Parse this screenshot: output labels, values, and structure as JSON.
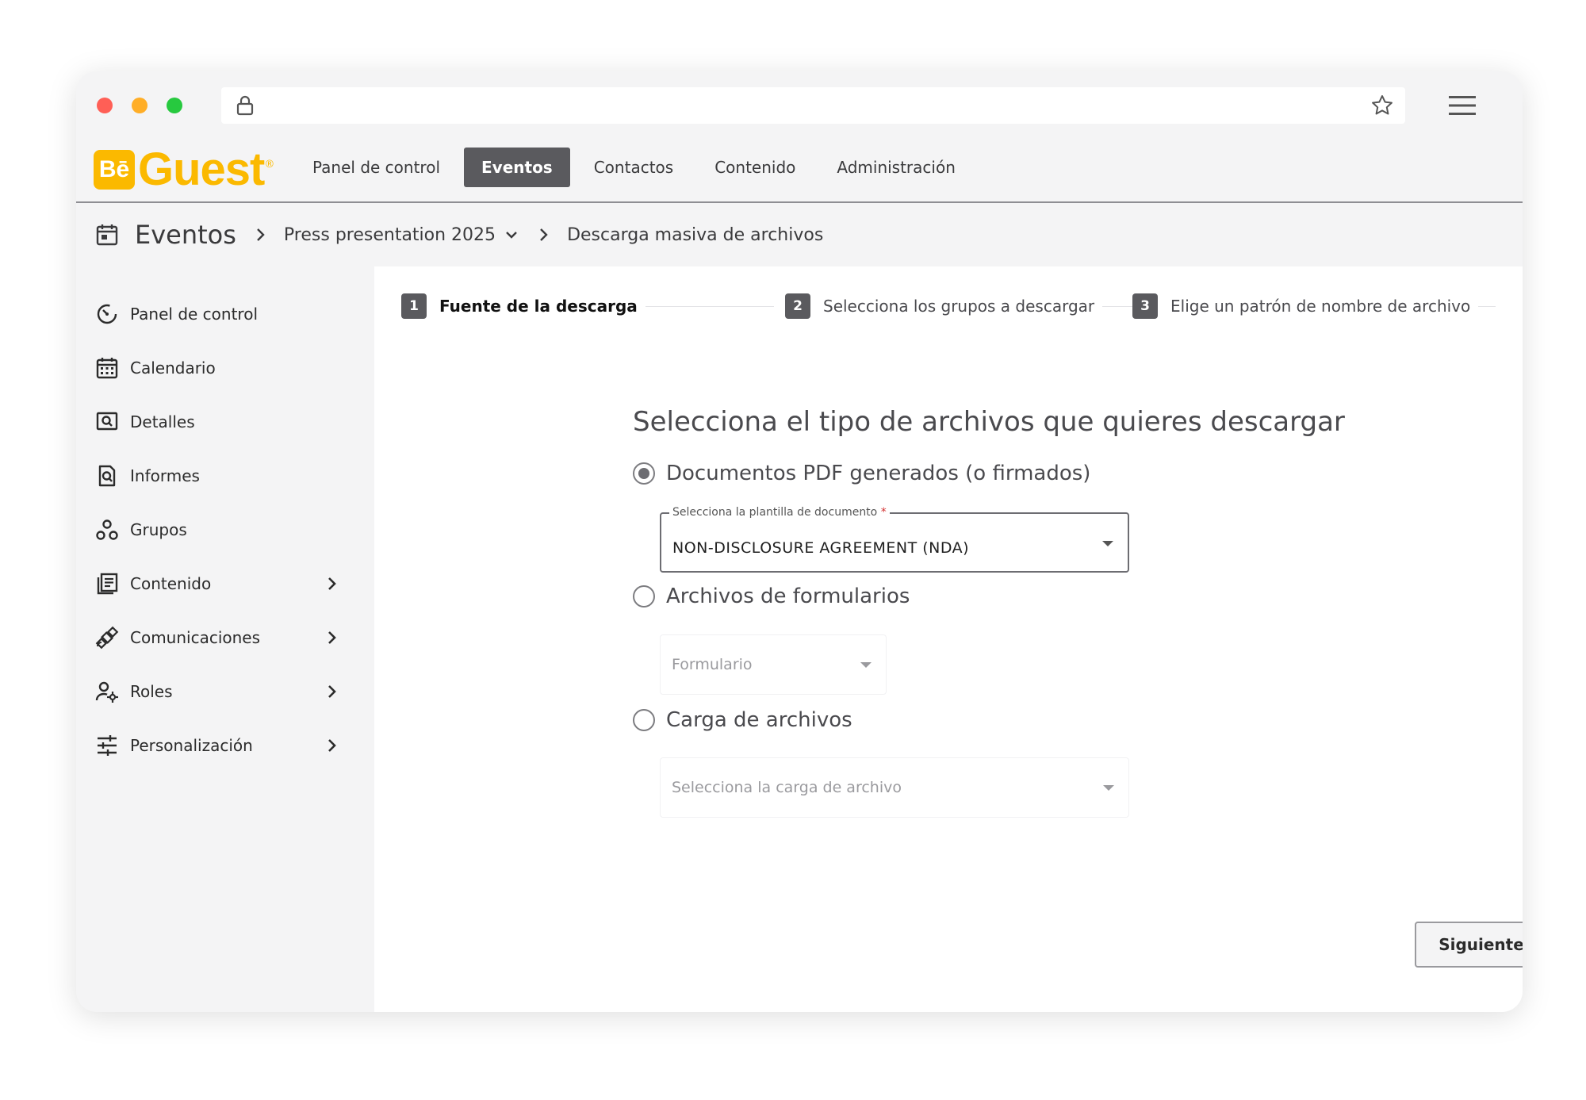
{
  "brand": {
    "badge": "Bē",
    "name": "Guest",
    "mark": "®",
    "color": "#fbb900"
  },
  "topnav": {
    "tabs": [
      {
        "label": "Panel de control",
        "active": false
      },
      {
        "label": "Eventos",
        "active": true
      },
      {
        "label": "Contactos",
        "active": false
      },
      {
        "label": "Contenido",
        "active": false
      },
      {
        "label": "Administración",
        "active": false
      }
    ]
  },
  "breadcrumb": {
    "root": "Eventos",
    "event": "Press presentation 2025",
    "current": "Descarga masiva de archivos"
  },
  "sidebar": {
    "items": [
      {
        "label": "Panel de control",
        "icon": "dashboard-icon",
        "has_submenu": false
      },
      {
        "label": "Calendario",
        "icon": "calendar-icon",
        "has_submenu": false
      },
      {
        "label": "Detalles",
        "icon": "details-icon",
        "has_submenu": false
      },
      {
        "label": "Informes",
        "icon": "report-icon",
        "has_submenu": false
      },
      {
        "label": "Grupos",
        "icon": "groups-icon",
        "has_submenu": false
      },
      {
        "label": "Contenido",
        "icon": "content-icon",
        "has_submenu": true
      },
      {
        "label": "Comunicaciones",
        "icon": "satellite-icon",
        "has_submenu": true
      },
      {
        "label": "Roles",
        "icon": "roles-icon",
        "has_submenu": true
      },
      {
        "label": "Personalización",
        "icon": "sliders-icon",
        "has_submenu": true
      }
    ]
  },
  "stepper": {
    "steps": [
      {
        "number": "1",
        "label": "Fuente de la descarga",
        "current": true
      },
      {
        "number": "2",
        "label": "Selecciona los grupos a descargar",
        "current": false
      },
      {
        "number": "3",
        "label": "Elige un patrón de nombre de archivo",
        "current": false
      }
    ]
  },
  "form": {
    "title": "Selecciona el tipo de archivos que quieres descargar",
    "options": [
      {
        "label": "Documentos PDF generados (o firmados)",
        "checked": true,
        "select": {
          "legend": "Selecciona la plantilla de documento",
          "required_mark": "*",
          "value": "NON-DISCLOSURE AGREEMENT (NDA)"
        }
      },
      {
        "label": "Archivos de formularios",
        "checked": false,
        "select": {
          "placeholder": "Formulario"
        }
      },
      {
        "label": "Carga de archivos",
        "checked": false,
        "select": {
          "placeholder": "Selecciona la carga de archivo"
        }
      }
    ],
    "next_label": "Siguiente"
  }
}
